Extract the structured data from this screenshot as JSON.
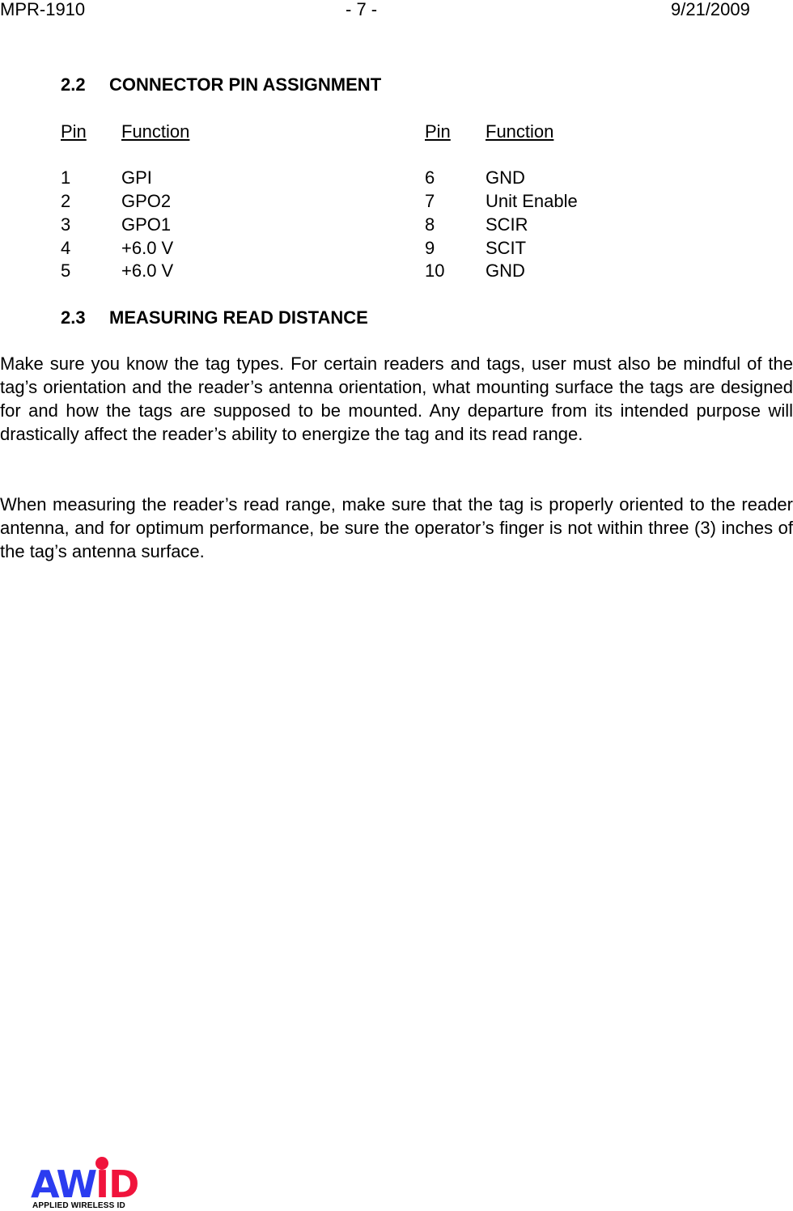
{
  "header": {
    "doc_id": "MPR-1910",
    "page": "- 7 -",
    "date": "9/21/2009"
  },
  "section_2_2": {
    "number": "2.2",
    "title": "CONNECTOR PIN ASSIGNMENT",
    "columns": [
      {
        "pin_header": "Pin",
        "function_header": "Function",
        "rows": [
          {
            "pin": "1",
            "function": "GPI"
          },
          {
            "pin": "2",
            "function": "GPO2"
          },
          {
            "pin": "3",
            "function": "GPO1"
          },
          {
            "pin": "4",
            "function": "+6.0 V"
          },
          {
            "pin": "5",
            "function": "+6.0 V"
          }
        ]
      },
      {
        "pin_header": "Pin",
        "function_header": "Function",
        "rows": [
          {
            "pin": "6",
            "function": "GND"
          },
          {
            "pin": "7",
            "function": "Unit Enable"
          },
          {
            "pin": "8",
            "function": "SCIR"
          },
          {
            "pin": "9",
            "function": "SCIT"
          },
          {
            "pin": "10",
            "function": "GND"
          }
        ]
      }
    ]
  },
  "section_2_3": {
    "number": "2.3",
    "title": "MEASURING READ DISTANCE",
    "paragraphs": [
      "Make sure you know the tag types. For certain readers and tags, user must also be mindful of the tag’s orientation and the reader’s antenna orientation, what mounting surface the tags are designed for and how the tags are supposed to be mounted. Any departure from its intended purpose will drastically affect the reader’s ability to energize the tag and its read range.",
      "When measuring the reader’s read range, make sure that the tag is properly oriented to the reader antenna, and for optimum performance, be sure the operator’s finger is not within three (3) inches of the tag’s antenna surface."
    ]
  },
  "logo": {
    "letters_blue": "AW",
    "letters_red": "ID",
    "tagline": "APPLIED WIRELESS ID",
    "colors": {
      "blue": "#2b3cf0",
      "red": "#f0143c"
    }
  }
}
